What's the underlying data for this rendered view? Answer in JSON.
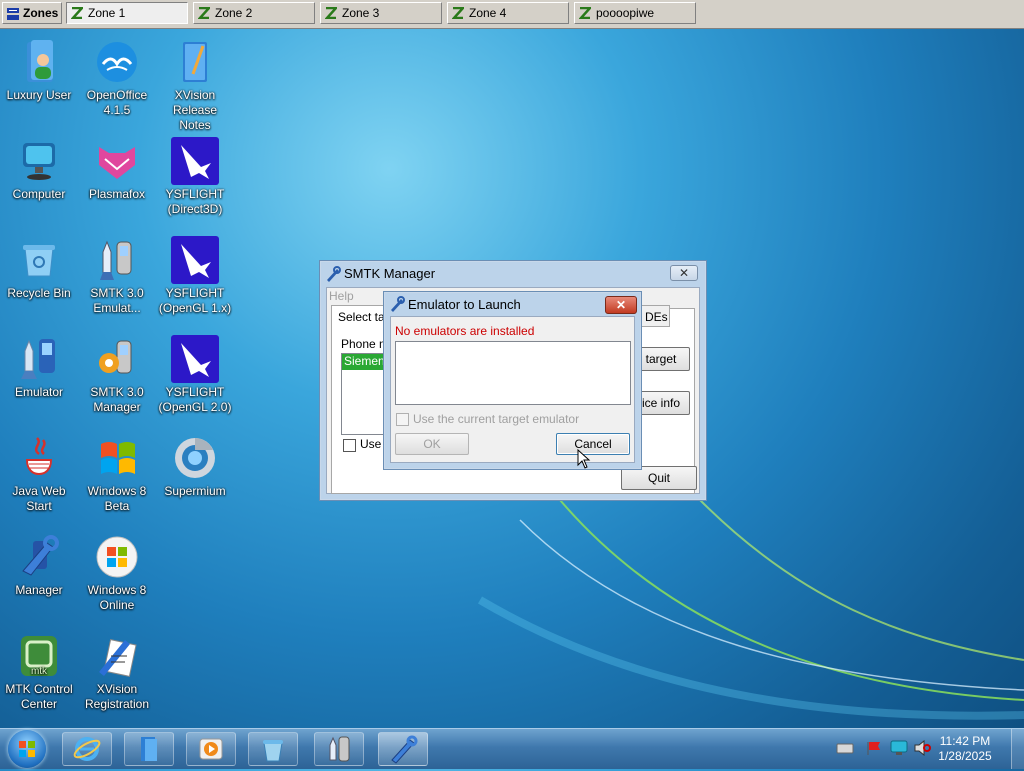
{
  "zones_bar": {
    "main_label": "Zones",
    "zones": [
      "Zone 1",
      "Zone 2",
      "Zone 3",
      "Zone 4",
      "poooopiwe"
    ],
    "active_zone": "Zone 1"
  },
  "desktop_icons": [
    {
      "label": "Luxury User",
      "icon": "user-folder-icon"
    },
    {
      "label": "OpenOffice 4.1.5",
      "icon": "openoffice-icon"
    },
    {
      "label": "XVision Release Notes",
      "icon": "notes-book-icon"
    },
    {
      "label": "Computer",
      "icon": "computer-icon"
    },
    {
      "label": "Plasmafox",
      "icon": "plasmafox-icon"
    },
    {
      "label": "YSFLIGHT (Direct3D)",
      "icon": "jet-icon"
    },
    {
      "label": "Recycle Bin",
      "icon": "recycle-bin-icon"
    },
    {
      "label": "SMTK 3.0 Emulat...",
      "icon": "phone-rocket-icon"
    },
    {
      "label": "YSFLIGHT (OpenGL 1.x)",
      "icon": "jet-icon"
    },
    {
      "label": "Emulator",
      "icon": "emulator-icon"
    },
    {
      "label": "SMTK 3.0 Manager",
      "icon": "phone-gear-icon"
    },
    {
      "label": "YSFLIGHT (OpenGL 2.0)",
      "icon": "jet-icon"
    },
    {
      "label": "Java Web Start",
      "icon": "java-icon"
    },
    {
      "label": "Windows 8 Beta",
      "icon": "windows-flag-icon"
    },
    {
      "label": "Supermium",
      "icon": "supermium-icon"
    },
    {
      "label": "Manager",
      "icon": "wrench-icon"
    },
    {
      "label": "Windows 8 Online",
      "icon": "windows-orb-icon"
    },
    {
      "label": "MTK Control Center",
      "icon": "mtk-icon"
    },
    {
      "label": "XVision Registration",
      "icon": "registration-icon"
    }
  ],
  "smtk_window": {
    "title": "SMTK Manager",
    "menu_help": "Help",
    "tab_select_target": "Select tar",
    "tab_ides": "DEs",
    "phone_models_label": "Phone m",
    "list_selected": "Siemens",
    "checkbox_label": "Use t",
    "target_button": "target",
    "device_info_button": "ice info",
    "quit_button": "Quit"
  },
  "emulator_dialog": {
    "title": "Emulator to Launch",
    "warning": "No emulators are installed",
    "checkbox_label": "Use the current target emulator",
    "ok_button": "OK",
    "cancel_button": "Cancel",
    "warning_color": "#cc0000"
  },
  "taskbar": {
    "time": "11:42 PM",
    "date": "1/28/2025",
    "items": [
      "start-orb-icon",
      "internet-explorer-icon",
      "files-icon",
      "media-player-icon",
      "bucket-icon",
      "smtk-phone-icon",
      "manager-wrench-icon"
    ],
    "tray": [
      "network-icon",
      "flag-icon",
      "monitor-icon",
      "speaker-icon"
    ]
  }
}
